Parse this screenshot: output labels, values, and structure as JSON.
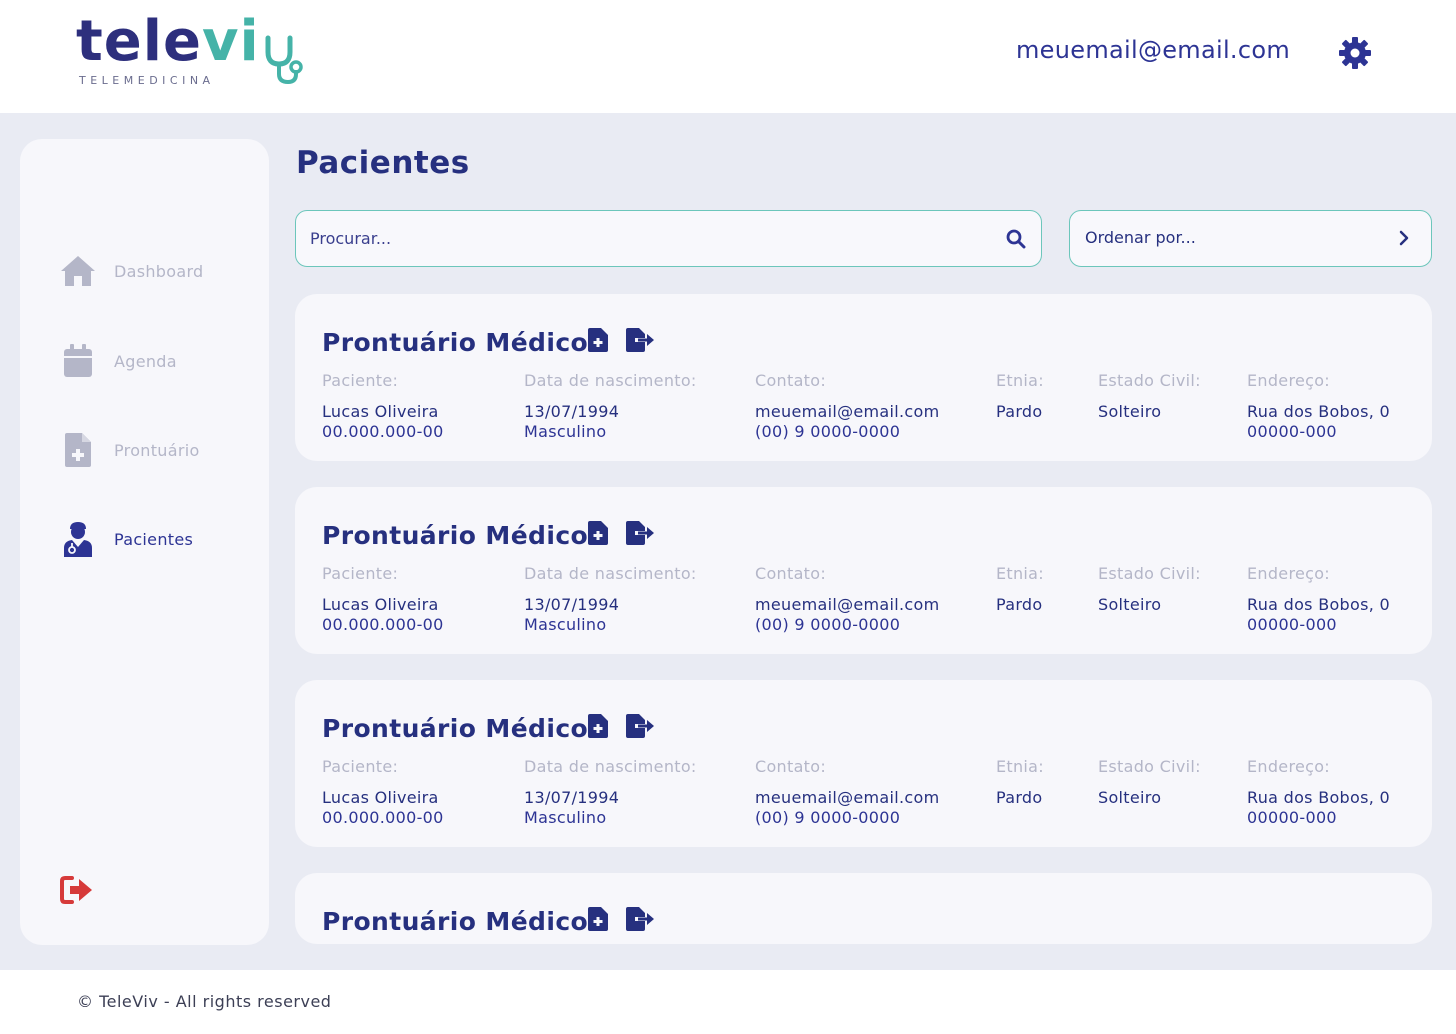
{
  "brand": {
    "name_main": "tele",
    "name_accent": "vi",
    "subtitle": "TELEMEDICINA"
  },
  "header": {
    "user_email": "meuemail@email.com"
  },
  "sidebar": {
    "items": [
      {
        "label": "Dashboard",
        "icon": "home-icon"
      },
      {
        "label": "Agenda",
        "icon": "calendar-icon"
      },
      {
        "label": "Prontuário",
        "icon": "file-medical-icon"
      },
      {
        "label": "Pacientes",
        "icon": "doctor-icon",
        "active": true
      }
    ]
  },
  "main": {
    "title": "Pacientes",
    "search": {
      "placeholder": "Procurar..."
    },
    "sort": {
      "label": "Ordenar por..."
    },
    "labels": {
      "paciente": "Paciente:",
      "nascimento": "Data de nascimento:",
      "contato": "Contato:",
      "etnia": "Etnia:",
      "estado_civil": "Estado Civil:",
      "endereco": "Endereço:"
    },
    "records": [
      {
        "title": "Prontuário Médico",
        "name": "Lucas Oliveira",
        "cpf": "00.000.000-00",
        "birth": "13/07/1994",
        "gender": "Masculino",
        "email": "meuemail@email.com",
        "phone": "(00) 9 0000-0000",
        "etnia": "Pardo",
        "estado_civil": "Solteiro",
        "address": "Rua dos Bobos, 0",
        "cep": "00000-000"
      },
      {
        "title": "Prontuário Médico",
        "name": "Lucas Oliveira",
        "cpf": "00.000.000-00",
        "birth": "13/07/1994",
        "gender": "Masculino",
        "email": "meuemail@email.com",
        "phone": "(00) 9 0000-0000",
        "etnia": "Pardo",
        "estado_civil": "Solteiro",
        "address": "Rua dos Bobos, 0",
        "cep": "00000-000"
      },
      {
        "title": "Prontuário Médico",
        "name": "Lucas Oliveira",
        "cpf": "00.000.000-00",
        "birth": "13/07/1994",
        "gender": "Masculino",
        "email": "meuemail@email.com",
        "phone": "(00) 9 0000-0000",
        "etnia": "Pardo",
        "estado_civil": "Solteiro",
        "address": "Rua dos Bobos, 0",
        "cep": "00000-000"
      },
      {
        "title": "Prontuário Médico"
      }
    ]
  },
  "footer": {
    "text": "© TeleViv - All rights reserved"
  },
  "colors": {
    "primary": "#26307f",
    "accent": "#45b3a8",
    "muted": "#b4b6c8",
    "danger": "#d63a3a",
    "background": "#e9ebf3"
  }
}
